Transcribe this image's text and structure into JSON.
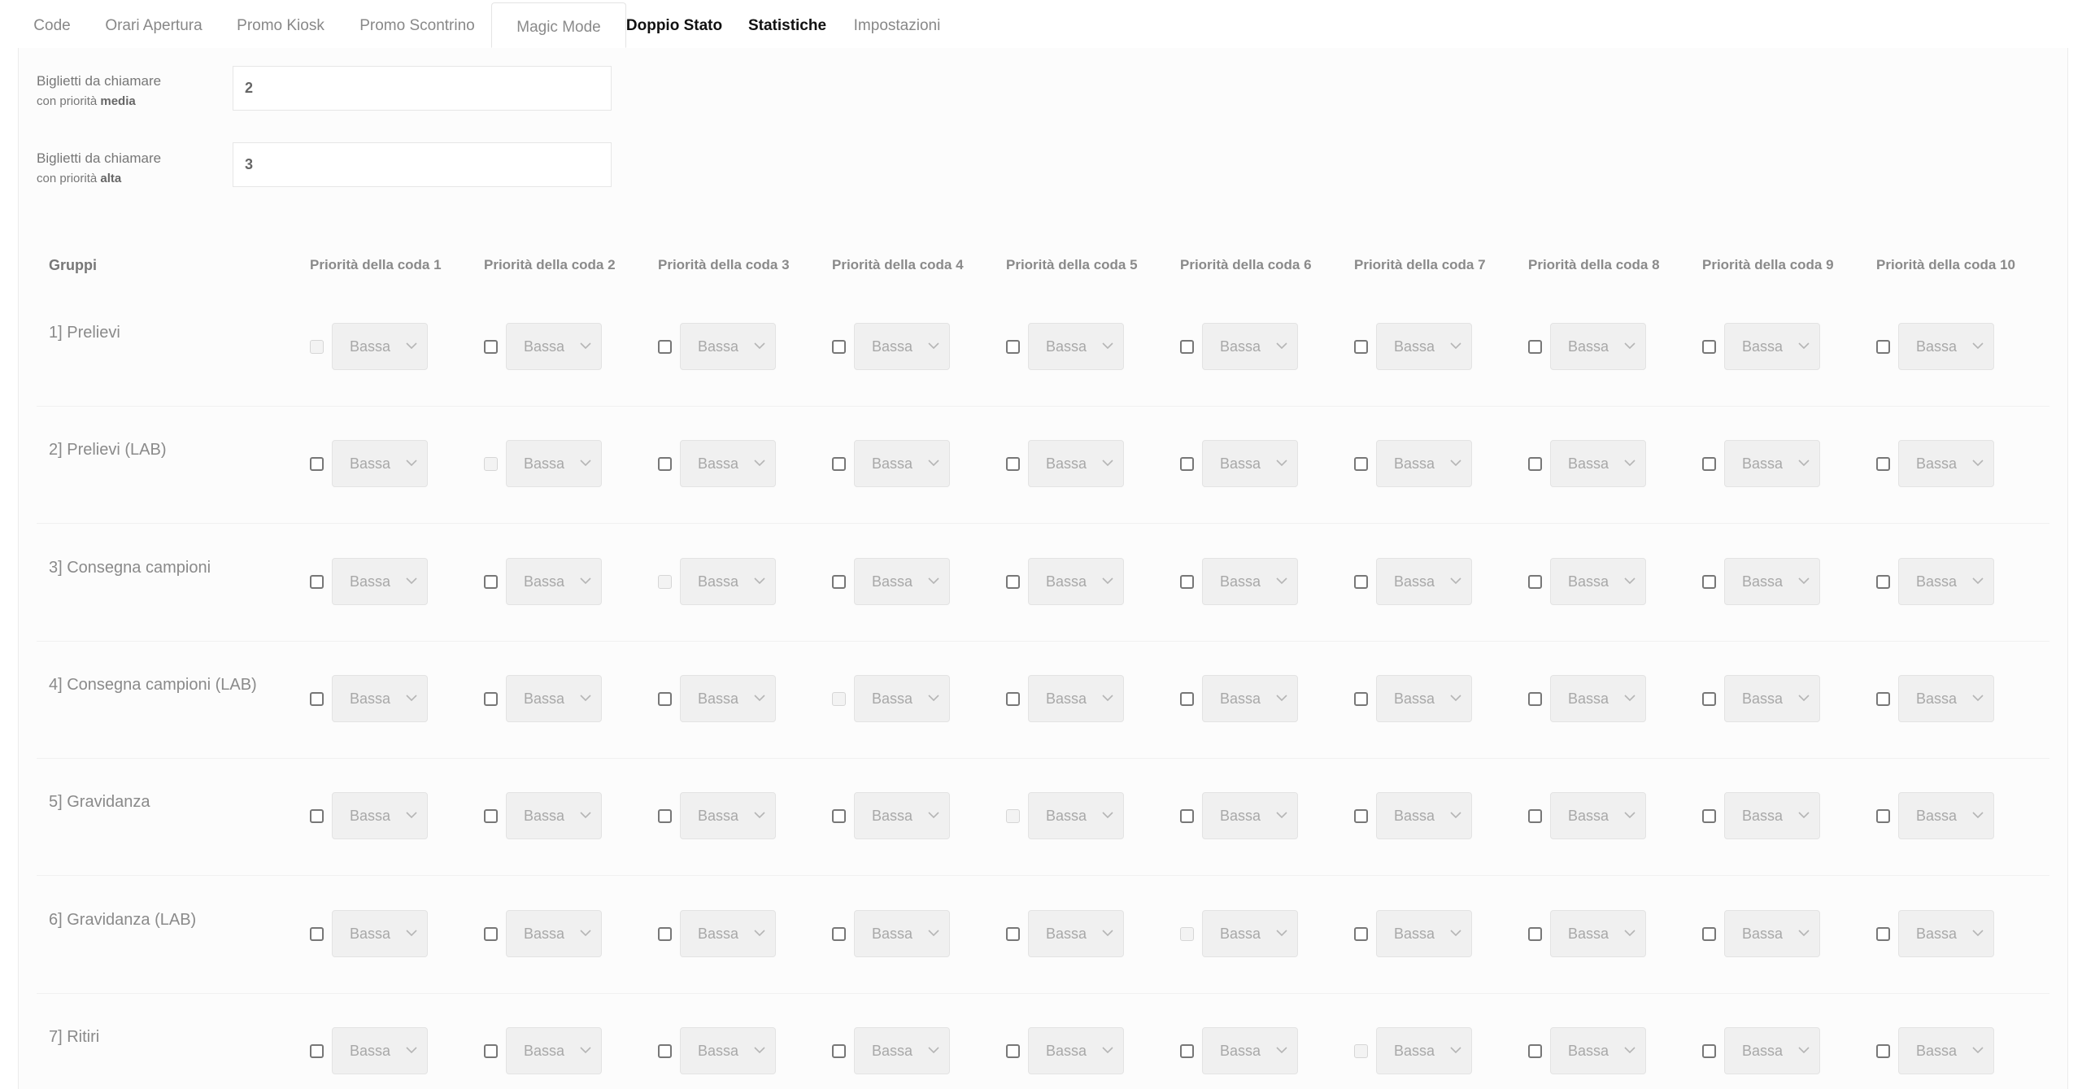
{
  "tabs": [
    {
      "label": "Code"
    },
    {
      "label": "Orari Apertura"
    },
    {
      "label": "Promo Kiosk"
    },
    {
      "label": "Promo Scontrino"
    },
    {
      "label": "Magic Mode"
    },
    {
      "label": "Doppio Stato"
    },
    {
      "label": "Statistiche"
    },
    {
      "label": "Impostazioni"
    }
  ],
  "settings": {
    "medium": {
      "label_line1": "Biglietti da chiamare",
      "label_prefix": "con priorità ",
      "label_bold": "media",
      "value": "2"
    },
    "high": {
      "label_line1": "Biglietti da chiamare",
      "label_prefix": "con priorità ",
      "label_bold": "alta",
      "value": "3"
    }
  },
  "table": {
    "header_groups": "Gruppi",
    "queue_headers": [
      "Priorità della coda 1",
      "Priorità della coda 2",
      "Priorità della coda 3",
      "Priorità della coda 4",
      "Priorità della coda 5",
      "Priorità della coda 6",
      "Priorità della coda 7",
      "Priorità della coda 8",
      "Priorità della coda 9",
      "Priorità della coda 10"
    ],
    "select_value": "Bassa",
    "groups": [
      {
        "name": "1] Prelievi",
        "disabled_queue": 1
      },
      {
        "name": "2] Prelievi (LAB)",
        "disabled_queue": 2
      },
      {
        "name": "3] Consegna campioni",
        "disabled_queue": 3
      },
      {
        "name": "4] Consegna campioni (LAB)",
        "disabled_queue": 4
      },
      {
        "name": "5] Gravidanza",
        "disabled_queue": 5
      },
      {
        "name": "6] Gravidanza (LAB)",
        "disabled_queue": 6
      },
      {
        "name": "7] Ritiri",
        "disabled_queue": 7
      }
    ]
  }
}
